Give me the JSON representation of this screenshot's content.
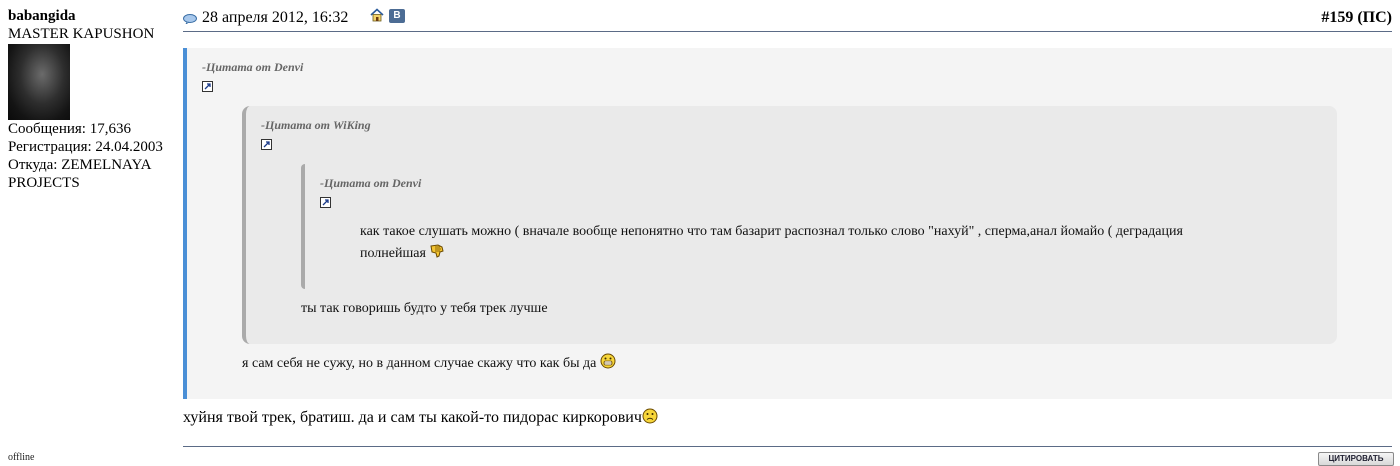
{
  "user": {
    "name": "babangida",
    "title": "MASTER KAPUSHON",
    "posts": "Сообщения: 17,636",
    "registered": "Регистрация: 24.04.2003",
    "location_line1": "Откуда: ZEMELNAYA",
    "location_line2": "PROJECTS",
    "status": "offline"
  },
  "post": {
    "date": "28 апреля 2012, 16:32",
    "number": "#159",
    "number_suffix": " (ПС)",
    "vk_label": "В",
    "quote_button": "ЦИТИРОВАТЬ"
  },
  "quotes": {
    "q1_author": "-Цитата от Denvi",
    "q2_author": "-Цитата от WiKing",
    "q3_author": "-Цитата от Denvi",
    "q3_text_line1": "как такое слушать можно ( вначале вообще непонятно что там базарит распознал только слово \"нахуй\" , сперма,анал йомайо ( деградация",
    "q3_text_line2": "полнейшая",
    "q2_text": "ты так говоришь будто у тебя трек лучше",
    "q1_text": "я сам себя не сужу, но в данном случае скажу что как бы да"
  },
  "reply": {
    "text": "хуйня твой трек, братиш. да и сам ты какой-то пидорас киркорович"
  },
  "colors": {
    "quote_bar_outer": "#4a8fd6",
    "quote_bar_inner": "#aaaaaa",
    "divider": "#5b6b86",
    "vk_blue": "#4c6c94"
  },
  "icons": [
    "post-icon",
    "home-icon",
    "vk-icon",
    "quote-link-icon",
    "thumbs-down-smiley",
    "grin-smiley",
    "sad-smiley",
    "avatar"
  ]
}
